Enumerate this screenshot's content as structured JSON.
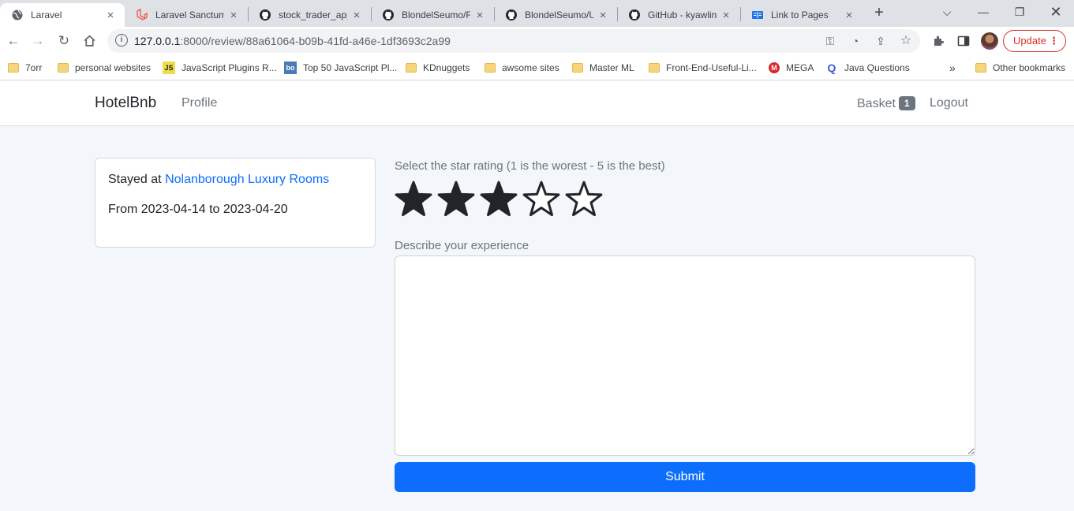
{
  "browser": {
    "tabs": [
      {
        "title": "Laravel",
        "icon": "globe-icon",
        "active": true
      },
      {
        "title": "Laravel Sanctum",
        "icon": "laravel-icon",
        "active": false
      },
      {
        "title": "stock_trader_app",
        "icon": "github-icon",
        "active": false
      },
      {
        "title": "BlondelSeumo/Fr",
        "icon": "github-icon",
        "active": false
      },
      {
        "title": "BlondelSeumo/U",
        "icon": "github-icon",
        "active": false
      },
      {
        "title": "GitHub - kyawlin",
        "icon": "github-icon",
        "active": false
      },
      {
        "title": "Link to Pages",
        "icon": "book-icon",
        "active": false
      }
    ],
    "address": {
      "host": "127.0.0.1",
      "rest": ":8000/review/88a61064-b09b-41fd-a46e-1df3693c2a99"
    },
    "update_label": "Update",
    "bookmarks": [
      {
        "label": "7orr",
        "icon": "folder-icon"
      },
      {
        "label": "personal websites",
        "icon": "folder-icon"
      },
      {
        "label": "JavaScript Plugins R...",
        "icon": "js-icon"
      },
      {
        "label": "Top 50 JavaScript Pl...",
        "icon": "bo-icon"
      },
      {
        "label": "KDnuggets",
        "icon": "folder-icon"
      },
      {
        "label": "awsome sites",
        "icon": "folder-icon"
      },
      {
        "label": "Master ML",
        "icon": "folder-icon"
      },
      {
        "label": "Front-End-Useful-Li...",
        "icon": "folder-icon"
      },
      {
        "label": "MEGA",
        "icon": "mega-icon"
      },
      {
        "label": "Java Questions",
        "icon": "q-icon"
      }
    ],
    "overflow": "»",
    "other_bookmarks": "Other bookmarks"
  },
  "navbar": {
    "brand": "HotelBnb",
    "profile": "Profile",
    "basket": "Basket",
    "basket_count": "1",
    "logout": "Logout"
  },
  "stay": {
    "prefix": "Stayed at",
    "hotel": "Nolanborough Luxury Rooms",
    "dates": "From 2023-04-14 to 2023-04-20"
  },
  "review": {
    "rating_label": "Select the star rating (1 is the worest - 5 is the best)",
    "rating_value": 3,
    "rating_max": 5,
    "experience_label": "Describe your experience",
    "experience_value": "",
    "submit_label": "Submit"
  },
  "colors": {
    "primary": "#0d6efd",
    "star": "#212529",
    "muted": "#6c757d",
    "page_bg": "#f3f6fb"
  }
}
